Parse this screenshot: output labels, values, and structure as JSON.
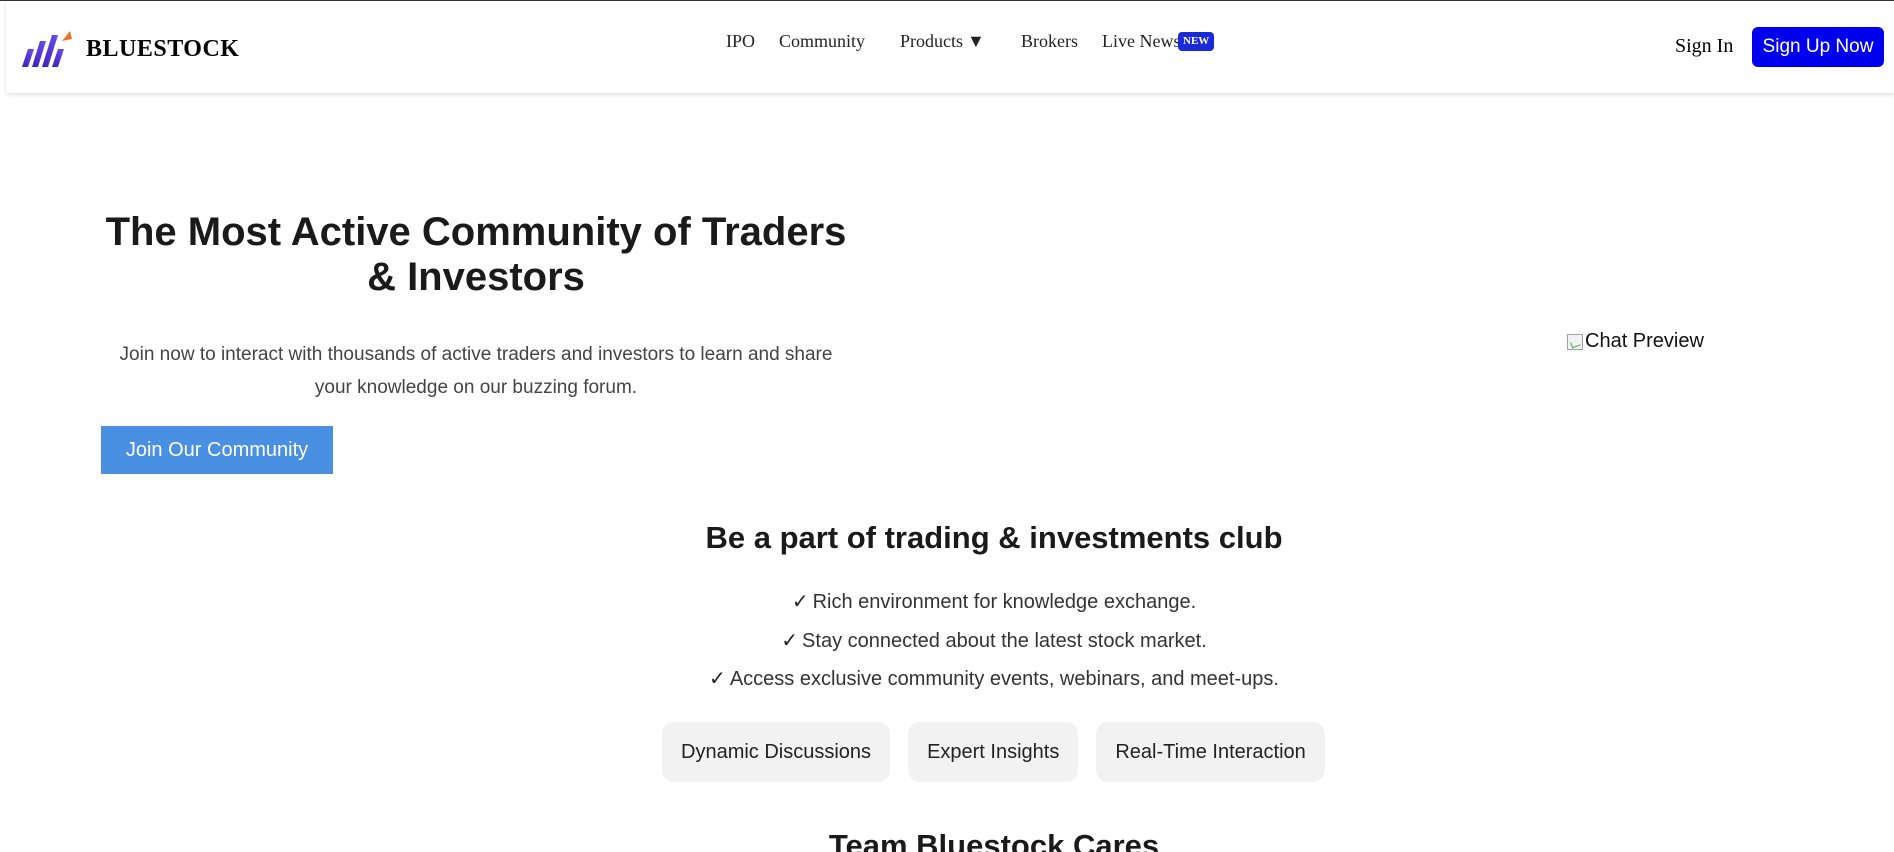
{
  "header": {
    "brand": "BLUESTOCK",
    "nav": [
      {
        "label": "IPO"
      },
      {
        "label": "Community"
      },
      {
        "label": "Products",
        "caret": "▼"
      },
      {
        "label": "Brokers"
      },
      {
        "label": "Live News",
        "badge": "NEW"
      }
    ],
    "sign_in": "Sign In",
    "sign_up": "Sign Up Now"
  },
  "hero": {
    "title": "The Most Active Community of Traders & Investors",
    "subtitle": "Join now to interact with thousands of active traders and investors to learn and share your knowledge on our buzzing forum.",
    "cta": "Join Our Community",
    "image_alt": "Chat Preview"
  },
  "club": {
    "title": "Be a part of trading & investments club",
    "check_mark": "✓",
    "benefits": [
      "Rich environment for knowledge exchange.",
      "Stay connected about the latest stock market.",
      "Access exclusive community events, webinars, and meet-ups."
    ],
    "features": [
      "Dynamic Discussions",
      "Expert Insights",
      "Real-Time Interaction"
    ]
  },
  "team": {
    "title": "Team Bluestock Cares"
  },
  "colors": {
    "primary": "#0000ee",
    "cta": "#4a90e2",
    "badge": "#1a2ad8",
    "chip_bg": "#f2f2f2"
  }
}
